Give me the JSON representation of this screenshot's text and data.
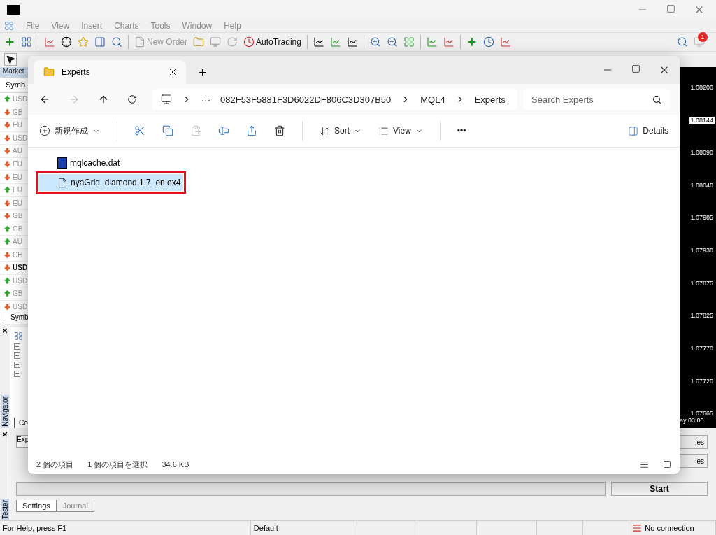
{
  "title_bar": {
    "menu": [
      "File",
      "View",
      "Insert",
      "Charts",
      "Tools",
      "Window",
      "Help"
    ]
  },
  "toolbar": {
    "new_order": "New Order",
    "auto_trading": "AutoTrading",
    "notification_count": "1"
  },
  "market_watch": {
    "tab": "Market",
    "header": "Symb",
    "bottom_tab": "Symb",
    "rows": [
      {
        "symbol": "USD",
        "rising": true,
        "selected": false
      },
      {
        "symbol": "GB",
        "rising": false,
        "selected": false
      },
      {
        "symbol": "EU",
        "rising": false,
        "selected": false
      },
      {
        "symbol": "USD",
        "rising": false,
        "selected": false
      },
      {
        "symbol": "AU",
        "rising": false,
        "selected": false
      },
      {
        "symbol": "EU",
        "rising": false,
        "selected": false
      },
      {
        "symbol": "EU",
        "rising": false,
        "selected": false
      },
      {
        "symbol": "EU",
        "rising": true,
        "selected": false
      },
      {
        "symbol": "EU",
        "rising": false,
        "selected": false
      },
      {
        "symbol": "GB",
        "rising": false,
        "selected": false
      },
      {
        "symbol": "GB",
        "rising": true,
        "selected": false
      },
      {
        "symbol": "AU",
        "rising": true,
        "selected": false
      },
      {
        "symbol": "CH",
        "rising": false,
        "selected": false
      },
      {
        "symbol": "USD",
        "rising": false,
        "selected": true
      },
      {
        "symbol": "USD",
        "rising": true,
        "selected": false
      },
      {
        "symbol": "GB",
        "rising": true,
        "selected": false
      },
      {
        "symbol": "USD",
        "rising": false,
        "selected": false
      }
    ]
  },
  "navigator": {
    "title": "Navigator",
    "tab": "Co",
    "nodes": [
      {
        "expanded": false
      },
      {
        "expanded": false
      },
      {
        "expanded": false
      },
      {
        "expanded": false
      }
    ]
  },
  "chart": {
    "prices": [
      {
        "text": "1.08200",
        "current": false
      },
      {
        "text": "1.08144",
        "current": true
      },
      {
        "text": "1.08090",
        "current": false
      },
      {
        "text": "1.08040",
        "current": false
      },
      {
        "text": "1.07985",
        "current": false
      },
      {
        "text": "1.07930",
        "current": false
      },
      {
        "text": "1.07875",
        "current": false
      },
      {
        "text": "1.07825",
        "current": false
      },
      {
        "text": "1.07770",
        "current": false
      },
      {
        "text": "1.07720",
        "current": false
      },
      {
        "text": "1.07665",
        "current": false
      }
    ],
    "time_label": "ay 03:00"
  },
  "tester": {
    "title": "Tester",
    "field": "Exp",
    "buttons": [
      "ies",
      "ies"
    ],
    "progress": {
      "level": 0
    },
    "start": "Start",
    "tabs": [
      {
        "label": "Settings",
        "selected": true
      },
      {
        "label": "Journal",
        "selected": false
      }
    ]
  },
  "status_bar": {
    "help": "For Help, press F1",
    "profile": "Default",
    "connection": "No connection"
  },
  "explorer": {
    "tab": "Experts",
    "path": [
      "082F53F5881F3D6022DF806C3D307B50",
      "MQL4",
      "Experts"
    ],
    "path_more": "···",
    "search": {
      "placeholder": "Search Experts"
    },
    "commands": {
      "new": "新規作成",
      "sort": "Sort",
      "view": "View",
      "more": "•••",
      "details": "Details"
    },
    "files": [
      {
        "name": "mqlcache.dat",
        "kind": "data",
        "selected": false,
        "highlighted": false
      },
      {
        "name": "nyaGrid_diamond.1.7_en.ex4",
        "kind": "file",
        "selected": true,
        "highlighted": true
      }
    ],
    "status": [
      "2 個の項目",
      "1 個の項目を選択",
      "34.6 KB"
    ]
  }
}
